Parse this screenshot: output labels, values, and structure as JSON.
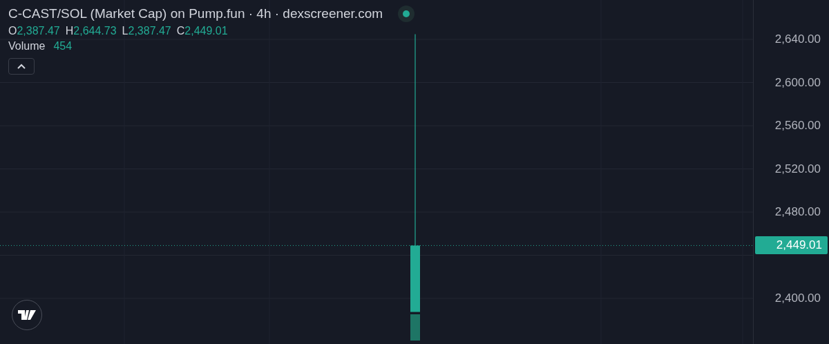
{
  "title": "C-CAST/SOL (Market Cap) on Pump.fun · 4h · dexscreener.com",
  "live": true,
  "ohlc": [
    {
      "label": "O",
      "value": "2,387.47"
    },
    {
      "label": "H",
      "value": "2,644.73"
    },
    {
      "label": "L",
      "value": "2,387.47"
    },
    {
      "label": "C",
      "value": "2,449.01"
    }
  ],
  "volume": {
    "label": "Volume",
    "value": "454"
  },
  "price_axis": {
    "ticks": [
      "2,640.00",
      "2,600.00",
      "2,560.00",
      "2,520.00",
      "2,480.00",
      "2,400.00"
    ],
    "last_price": "2,449.01"
  }
}
